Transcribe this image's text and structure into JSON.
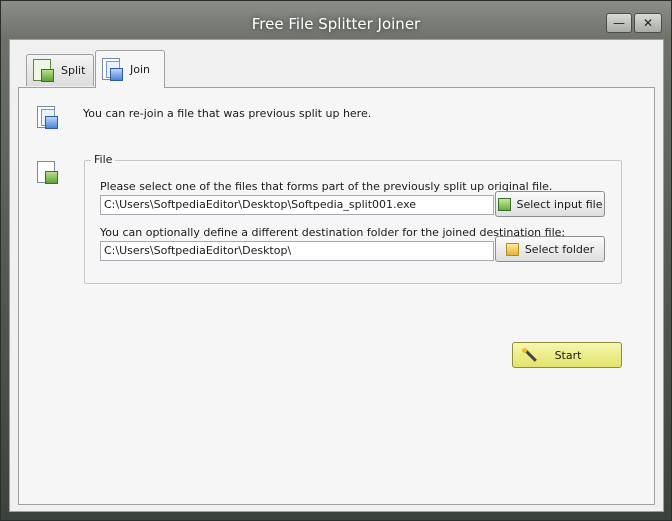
{
  "window": {
    "title": "Free File Splitter Joiner",
    "minimize_symbol": "—",
    "close_symbol": "✕"
  },
  "tabs": [
    {
      "label": "Split",
      "icon": "split-icon",
      "selected": false
    },
    {
      "label": "Join",
      "icon": "join-icon",
      "selected": true
    }
  ],
  "join": {
    "header_text": "You can re-join a file that was previous split up here.",
    "group_title": "File",
    "input_label": "Please select one of the files that forms part of the previously split up original file.",
    "input_value": "C:\\Users\\SoftpediaEditor\\Desktop\\Softpedia_split001.exe",
    "select_input_label": "Select input file",
    "dest_label": "You can optionally define a different destination folder for the joined destination file:",
    "dest_value": "C:\\Users\\SoftpediaEditor\\Desktop\\",
    "select_folder_label": "Select folder",
    "start_label": "Start"
  },
  "colors": {
    "start_button": "#e8e87a",
    "panel": "#f6f6f6"
  }
}
